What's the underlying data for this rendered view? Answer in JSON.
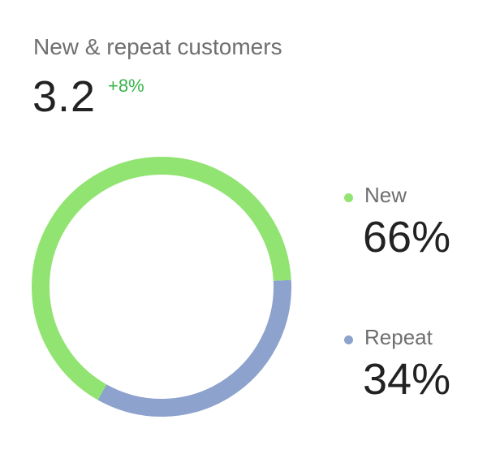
{
  "card": {
    "title": "New & repeat customers",
    "metric": "3.2",
    "delta": "+8%",
    "delta_color": "#39b54a"
  },
  "chart_data": {
    "type": "pie",
    "donut": true,
    "categories": [
      "New",
      "Repeat"
    ],
    "values": [
      66,
      34
    ],
    "value_labels": [
      "66%",
      "34%"
    ],
    "colors": [
      "#92e472",
      "#8da2cc"
    ],
    "legend": "right"
  }
}
